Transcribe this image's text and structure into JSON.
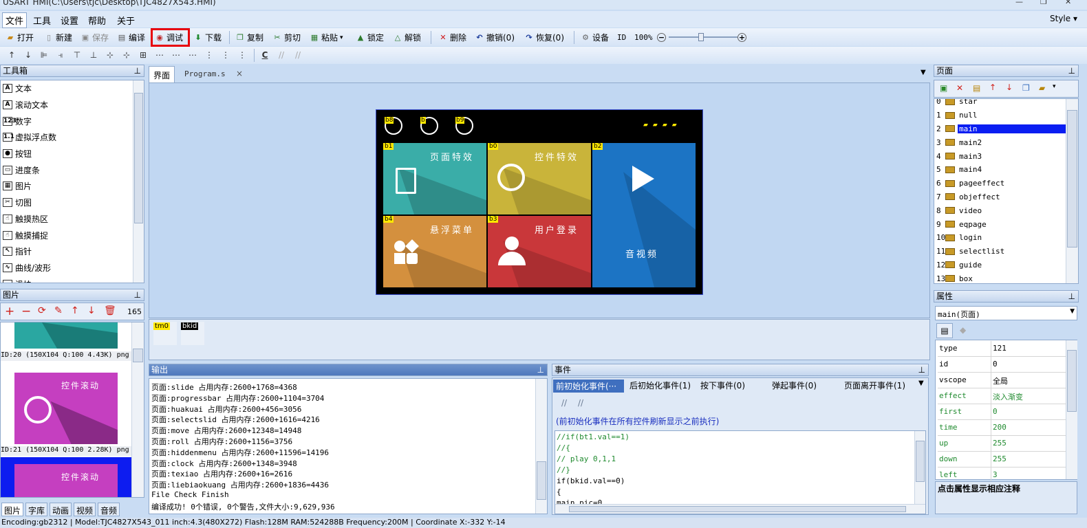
{
  "window": {
    "title": "USART HMI(C:\\Users\\tjc\\Desktop\\TJC4827X543.HMI)"
  },
  "menu": {
    "items": [
      "文件",
      "工具",
      "设置",
      "帮助",
      "关于"
    ],
    "style_label": "Style"
  },
  "toolbar": {
    "open": "打开",
    "new": "新建",
    "save": "保存",
    "compile": "编译",
    "debug": "调试",
    "download": "下载",
    "copy": "复制",
    "cut": "剪切",
    "paste": "粘贴",
    "lock": "锁定",
    "unlock": "解锁",
    "delete": "删除",
    "undo": "撤销(0)",
    "redo": "恢复(0)",
    "device": "设备",
    "id": "ID",
    "zoom": "100%"
  },
  "toolbox": {
    "title": "工具箱",
    "items": [
      "文本",
      "滚动文本",
      "数字",
      "虚拟浮点数",
      "按钮",
      "进度条",
      "图片",
      "切图",
      "触摸热区",
      "触摸捕捉",
      "指针",
      "曲线/波形",
      "滑块"
    ],
    "icons": [
      "A",
      "A",
      "123",
      "1.1",
      "●",
      "▭",
      "▦",
      "✂",
      "☝",
      "☝",
      "↖",
      "∿",
      ""
    ]
  },
  "images_panel": {
    "title": "图片",
    "count": "165",
    "entries": [
      {
        "caption": "ID:20  (150X104 Q:100 4.43K) png",
        "label": ""
      },
      {
        "caption": "ID:21  (150X104 Q:100 2.28K) png",
        "label": "控件滚动"
      },
      {
        "caption": "",
        "label": "控件滚动"
      }
    ]
  },
  "editor_tabs": [
    "界面",
    "Program.s"
  ],
  "tab_close": "×",
  "canvas": {
    "top_icons": [
      "b8",
      "b",
      "b9"
    ],
    "tiles": [
      {
        "tag": "b1",
        "label": "页面特效",
        "color": "#3aada8"
      },
      {
        "tag": "b0",
        "label": "控件特效",
        "color": "#c9b43a"
      },
      {
        "tag": "b2",
        "label": "音视频",
        "color": "#1c74c4"
      },
      {
        "tag": "b4",
        "label": "悬浮菜单",
        "color": "#d4903e"
      },
      {
        "tag": "b3",
        "label": "用户登录",
        "color": "#c9373a"
      }
    ]
  },
  "component_strip": {
    "items": [
      "tm0",
      "bkid"
    ]
  },
  "output": {
    "title": "输出",
    "lines": [
      "页面:slide 占用内存:2600+1768=4368",
      "页面:progressbar 占用内存:2600+1104=3704",
      "页面:huakuai 占用内存:2600+456=3056",
      "页面:selectslid 占用内存:2600+1616=4216",
      "页面:move 占用内存:2600+12348=14948",
      "页面:roll 占用内存:2600+1156=3756",
      "页面:hiddenmenu 占用内存:2600+11596=14196",
      "页面:clock 占用内存:2600+1348=3948",
      "页面:texiao 占用内存:2600+16=2616",
      "页面:liebiaokuang 占用内存:2600+1836=4436",
      "File Check Finish",
      "编译成功! 0个错误, 0个警告,文件大小:9,629,936"
    ]
  },
  "events": {
    "title": "事件",
    "tabs": [
      "前初始化事件(···",
      "后初始化事件(1)",
      "按下事件(0)",
      "弹起事件(0)",
      "页面离开事件(1)"
    ],
    "note": "(前初始化事件在所有控件刷新显示之前执行)",
    "code": [
      "//if(bt1.val==1)",
      "//{",
      "//  play 0,1,1",
      "//}",
      "if(bkid.val==0)",
      "{",
      "  main.pic=0"
    ]
  },
  "pages": {
    "title": "页面",
    "items": [
      "star",
      "null",
      "main",
      "main2",
      "main3",
      "main4",
      "pageeffect",
      "objeffect",
      "video",
      "eqpage",
      "login",
      "selectlist",
      "guide",
      "box"
    ],
    "selected": 2
  },
  "properties": {
    "title": "属性",
    "object": "main(页面)",
    "rows": [
      {
        "k": "type",
        "v": "121",
        "green": false
      },
      {
        "k": "id",
        "v": "0",
        "green": false
      },
      {
        "k": "vscope",
        "v": "全局",
        "green": false
      },
      {
        "k": "effect",
        "v": "淡入渐变",
        "green": true
      },
      {
        "k": "first",
        "v": "0",
        "green": true
      },
      {
        "k": "time",
        "v": "200",
        "green": true
      },
      {
        "k": "up",
        "v": "255",
        "green": true
      },
      {
        "k": "down",
        "v": "255",
        "green": true
      },
      {
        "k": "left",
        "v": "3",
        "green": true
      }
    ],
    "hint": "点击属性显示相应注释"
  },
  "bottom_tabs": [
    "图片",
    "字库",
    "动画",
    "视频",
    "音频"
  ],
  "status": "Encoding:gb2312  |  Model:TJC4827X543_011  inch:4.3(480X272) Flash:128M RAM:524288B Frequency:200M   |   Coordinate X:-332  Y:-14"
}
